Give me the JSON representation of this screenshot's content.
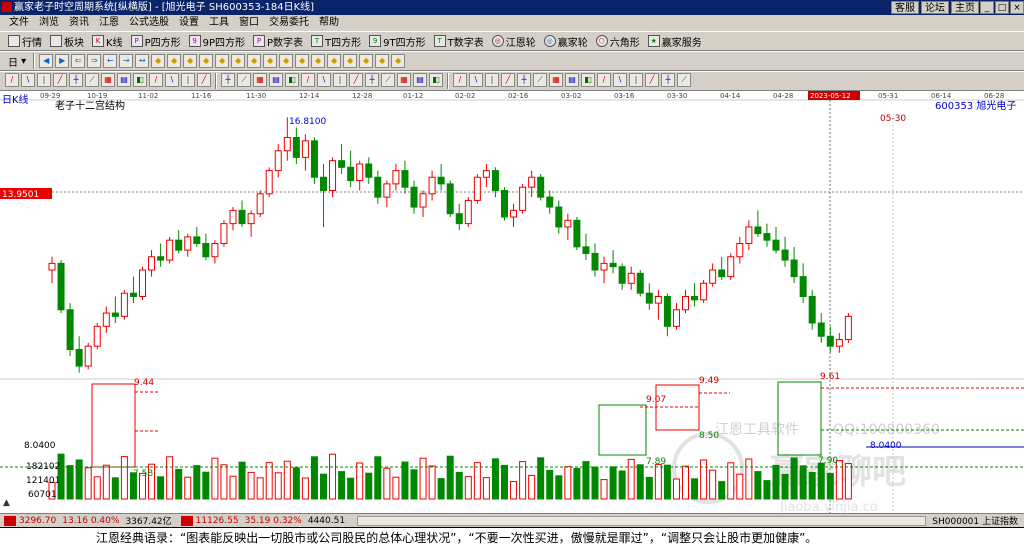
{
  "window": {
    "title": "赢家老子时空周期系统[纵横版] - [旭光电子 SH600353-184日K线]",
    "buttons": [
      "客服",
      "论坛",
      "主页"
    ],
    "win_controls": [
      "_",
      "□",
      "×"
    ]
  },
  "menu": [
    "文件",
    "浏览",
    "资讯",
    "江恩",
    "公式选股",
    "设置",
    "工具",
    "窗口",
    "交易委托",
    "帮助"
  ],
  "toolbar1": [
    {
      "label": "行情",
      "icon": "grid-icon"
    },
    {
      "label": "板块",
      "icon": "blocks-icon"
    },
    {
      "label": "K线",
      "icon": "candle-icon"
    },
    {
      "label": "P四方形",
      "icon": "square-p-icon"
    },
    {
      "label": "9P四方形",
      "icon": "square-9p-icon"
    },
    {
      "label": "P数字表",
      "icon": "table-p-icon"
    },
    {
      "label": "T四方形",
      "icon": "square-t-icon"
    },
    {
      "label": "9T四方形",
      "icon": "square-9t-icon"
    },
    {
      "label": "T数字表",
      "icon": "table-t-icon"
    },
    {
      "label": "江恩轮",
      "icon": "wheel-icon"
    },
    {
      "label": "赢家轮",
      "icon": "win-wheel-icon"
    },
    {
      "label": "六角形",
      "icon": "hexagon-icon"
    },
    {
      "label": "赢家服务",
      "icon": "service-icon"
    }
  ],
  "toolbar2_first": "日",
  "chart": {
    "period_label": "日K线",
    "indicator_title": "老子十二宫结构",
    "stock_label": "600353 旭光电子",
    "date_axis": [
      "09-29",
      "10-19",
      "11-02",
      "11-16",
      "11-30",
      "12-14",
      "12-28",
      "01-12",
      "02-02",
      "02-16",
      "03-02",
      "03-16",
      "03-30",
      "04-14",
      "04-28",
      "2023-05-12",
      "05-31",
      "06-14",
      "06-28"
    ],
    "highlight_date": "2023-05-12",
    "future_date_label": "05-30",
    "cursor_price": "13.9501",
    "high_label": "16.8100",
    "last_price_label": "8.0400",
    "watermark_soft": "江恩工具软件",
    "watermark_qq": "QQ:100800360",
    "watermark_logo": "赢家聊吧",
    "watermark_url": "Jiaoba.yinjia.co",
    "box_labels": {
      "b1_top": "9.44",
      "b1_bot": "7.58",
      "b2_top": "9.49",
      "b2_mid": "9.07",
      "b2_bot": "8.50",
      "b3_bot": "7.89",
      "b4_top": "9.61",
      "b4_bot": "7.90"
    },
    "volume_labels": [
      "8.0400",
      "182102",
      "121401",
      "60701"
    ]
  },
  "chart_data": {
    "type": "candlestick",
    "note_series": "daily OHLC approximations",
    "candles": [
      [
        12.2,
        12.6,
        11.8,
        12.4
      ],
      [
        12.4,
        12.5,
        10.9,
        11.0
      ],
      [
        11.0,
        11.2,
        9.6,
        9.8
      ],
      [
        9.8,
        10.2,
        9.1,
        9.3
      ],
      [
        9.3,
        10.0,
        9.2,
        9.9
      ],
      [
        9.9,
        10.6,
        9.8,
        10.5
      ],
      [
        10.5,
        11.1,
        10.3,
        10.9
      ],
      [
        10.9,
        11.4,
        10.6,
        10.8
      ],
      [
        10.8,
        11.6,
        10.7,
        11.5
      ],
      [
        11.5,
        12.0,
        11.2,
        11.4
      ],
      [
        11.4,
        12.3,
        11.3,
        12.2
      ],
      [
        12.2,
        12.8,
        12.0,
        12.6
      ],
      [
        12.6,
        13.0,
        12.3,
        12.5
      ],
      [
        12.5,
        13.2,
        12.4,
        13.1
      ],
      [
        13.1,
        13.4,
        12.7,
        12.8
      ],
      [
        12.8,
        13.3,
        12.6,
        13.2
      ],
      [
        13.2,
        13.5,
        12.9,
        13.0
      ],
      [
        13.0,
        13.3,
        12.5,
        12.6
      ],
      [
        12.6,
        13.1,
        12.4,
        13.0
      ],
      [
        13.0,
        13.7,
        12.9,
        13.6
      ],
      [
        13.6,
        14.1,
        13.4,
        14.0
      ],
      [
        14.0,
        14.3,
        13.5,
        13.6
      ],
      [
        13.6,
        14.0,
        13.2,
        13.9
      ],
      [
        13.9,
        14.6,
        13.8,
        14.5
      ],
      [
        14.5,
        15.3,
        14.4,
        15.2
      ],
      [
        15.2,
        16.0,
        15.0,
        15.8
      ],
      [
        15.8,
        16.81,
        15.5,
        16.2
      ],
      [
        16.2,
        16.5,
        15.4,
        15.6
      ],
      [
        15.6,
        16.3,
        15.2,
        16.1
      ],
      [
        16.1,
        16.2,
        14.8,
        15.0
      ],
      [
        15.0,
        15.4,
        13.5,
        14.6
      ],
      [
        14.6,
        15.6,
        14.4,
        15.5
      ],
      [
        15.5,
        16.0,
        15.1,
        15.3
      ],
      [
        15.3,
        15.8,
        14.7,
        14.9
      ],
      [
        14.9,
        15.5,
        14.6,
        15.4
      ],
      [
        15.4,
        15.6,
        14.8,
        15.0
      ],
      [
        15.0,
        15.2,
        14.2,
        14.4
      ],
      [
        14.4,
        14.9,
        14.1,
        14.8
      ],
      [
        14.8,
        15.4,
        14.6,
        15.2
      ],
      [
        15.2,
        15.5,
        14.5,
        14.7
      ],
      [
        14.7,
        14.9,
        13.9,
        14.1
      ],
      [
        14.1,
        14.6,
        13.8,
        14.5
      ],
      [
        14.5,
        15.2,
        14.3,
        15.0
      ],
      [
        15.0,
        15.4,
        14.6,
        14.8
      ],
      [
        14.8,
        14.9,
        13.8,
        13.9
      ],
      [
        13.9,
        14.2,
        13.4,
        13.6
      ],
      [
        13.6,
        14.4,
        13.5,
        14.3
      ],
      [
        14.3,
        15.1,
        14.2,
        15.0
      ],
      [
        15.0,
        15.4,
        14.7,
        15.2
      ],
      [
        15.2,
        15.3,
        14.4,
        14.6
      ],
      [
        14.6,
        14.7,
        13.7,
        13.8
      ],
      [
        13.8,
        14.2,
        13.5,
        14.0
      ],
      [
        14.0,
        14.8,
        13.9,
        14.7
      ],
      [
        14.7,
        15.2,
        14.4,
        15.0
      ],
      [
        15.0,
        15.1,
        14.3,
        14.4
      ],
      [
        14.4,
        14.6,
        13.9,
        14.1
      ],
      [
        14.1,
        14.3,
        13.3,
        13.5
      ],
      [
        13.5,
        13.9,
        13.1,
        13.7
      ],
      [
        13.7,
        13.8,
        12.8,
        12.9
      ],
      [
        12.9,
        13.3,
        12.5,
        12.7
      ],
      [
        12.7,
        13.0,
        12.0,
        12.2
      ],
      [
        12.2,
        12.6,
        11.8,
        12.4
      ],
      [
        12.4,
        12.8,
        12.1,
        12.3
      ],
      [
        12.3,
        12.4,
        11.6,
        11.8
      ],
      [
        11.8,
        12.3,
        11.6,
        12.1
      ],
      [
        12.1,
        12.2,
        11.4,
        11.5
      ],
      [
        11.5,
        11.8,
        11.0,
        11.2
      ],
      [
        11.2,
        11.6,
        10.7,
        11.4
      ],
      [
        11.4,
        11.5,
        10.2,
        10.5
      ],
      [
        10.5,
        11.2,
        10.4,
        11.0
      ],
      [
        11.0,
        11.6,
        10.9,
        11.4
      ],
      [
        11.4,
        11.8,
        11.1,
        11.3
      ],
      [
        11.3,
        11.9,
        11.2,
        11.8
      ],
      [
        11.8,
        12.4,
        11.7,
        12.2
      ],
      [
        12.2,
        12.6,
        11.9,
        12.0
      ],
      [
        12.0,
        12.7,
        11.9,
        12.6
      ],
      [
        12.6,
        13.2,
        12.4,
        13.0
      ],
      [
        13.0,
        13.7,
        12.8,
        13.5
      ],
      [
        13.5,
        14.0,
        13.2,
        13.3
      ],
      [
        13.3,
        13.6,
        12.9,
        13.1
      ],
      [
        13.1,
        13.5,
        12.7,
        12.8
      ],
      [
        12.8,
        13.2,
        12.3,
        12.5
      ],
      [
        12.5,
        12.9,
        11.8,
        12.0
      ],
      [
        12.0,
        12.4,
        11.2,
        11.4
      ],
      [
        11.4,
        11.6,
        10.4,
        10.6
      ],
      [
        10.6,
        10.9,
        10.0,
        10.2
      ],
      [
        10.2,
        10.5,
        9.7,
        9.9
      ],
      [
        9.9,
        10.3,
        9.7,
        10.1
      ],
      [
        10.1,
        10.9,
        10.0,
        10.8
      ]
    ]
  },
  "status": {
    "idx1": "3296.70",
    "idx1_chg": "13.16 0.40%",
    "idx1_amt": "3367.42亿",
    "idx2": "11126.55",
    "idx2_chg": "35.19 0.32%",
    "idx2_amt": "4440.51",
    "index_name": "SH000001 上证指数"
  },
  "bottom_text": "江恩经典语录：“图表能反映出一切股市或公司股民的总体心理状况”，“不要一次性买进，傲慢就是罪过”，“调整只会让股市更加健康”。"
}
